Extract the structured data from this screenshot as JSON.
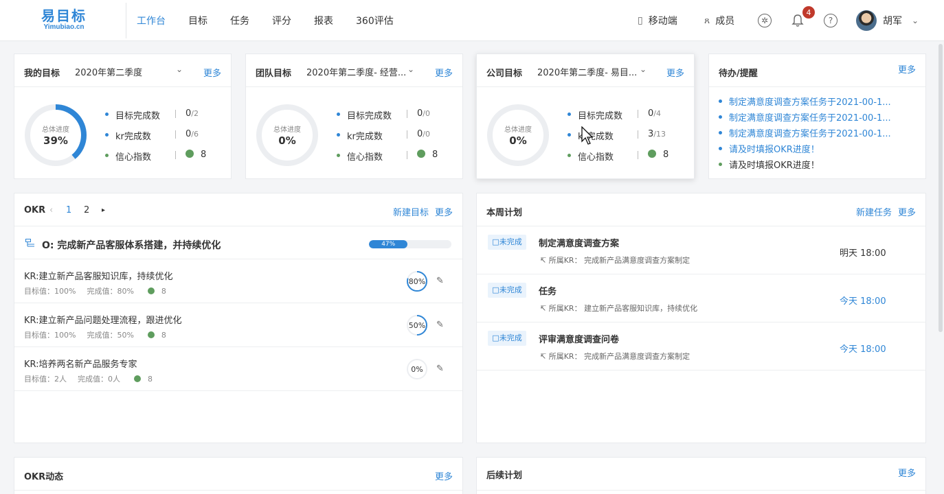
{
  "logo": {
    "cn": "易目标",
    "en": "Yimubiao.cn"
  },
  "nav": [
    "工作台",
    "目标",
    "任务",
    "评分",
    "报表",
    "360评估"
  ],
  "header": {
    "mobile": "移动端",
    "members": "成员",
    "notification_count": "4",
    "help": "?",
    "user": "胡军"
  },
  "stat_labels": {
    "goal_done": "目标完成数",
    "kr_done": "kr完成数",
    "confidence": "信心指数",
    "progress": "总体进度"
  },
  "my_goal": {
    "title": "我的目标",
    "period": "2020年第二季度",
    "more": "更多",
    "progress": "39%",
    "progress_value": 0.39,
    "goal_done": "0",
    "goal_total": "/2",
    "kr_done": "0",
    "kr_total": "/6",
    "confidence": "8"
  },
  "team_goal": {
    "title": "团队目标",
    "period": "2020年第二季度- 经营...",
    "more": "更多",
    "progress": "0%",
    "progress_value": 0,
    "goal_done": "0",
    "goal_total": "/0",
    "kr_done": "0",
    "kr_total": "/0",
    "confidence": "8"
  },
  "company_goal": {
    "title": "公司目标",
    "period": "2020年第二季度- 易目...",
    "more": "更多",
    "progress": "0%",
    "progress_value": 0,
    "goal_done": "0",
    "goal_total": "/4",
    "kr_done": "3",
    "kr_total": "/13",
    "confidence": "8"
  },
  "todo": {
    "title": "待办/提醒",
    "more": "更多",
    "items": [
      {
        "text": "制定满意度调查方案任务于2021-00-1...",
        "color": "#2f86d6"
      },
      {
        "text": "制定满意度调查方案任务于2021-00-1...",
        "color": "#2f86d6"
      },
      {
        "text": "制定满意度调查方案任务于2021-00-1...",
        "color": "#2f86d6"
      },
      {
        "text": "请及时填报OKR进度！",
        "color": "#2f86d6"
      },
      {
        "text": "请及时填报OKR进度！",
        "color": "#333333"
      }
    ]
  },
  "okr": {
    "title": "OKR",
    "pages": [
      "1",
      "2"
    ],
    "new_goal": "新建目标",
    "more": "更多",
    "objective": {
      "title": "O: 完成新产品客服体系搭建，并持续优化",
      "progress": "47%",
      "progress_value": 0.47
    },
    "krs": [
      {
        "title": "KR:建立新产品客服知识库，持续优化",
        "target": "目标值：100%",
        "done": "完成值：80%",
        "confidence": "8",
        "pct": "80%",
        "value": 0.8
      },
      {
        "title": "KR:建立新产品问题处理流程，跟进优化",
        "target": "目标值：100%",
        "done": "完成值：50%",
        "confidence": "8",
        "pct": "50%",
        "value": 0.5
      },
      {
        "title": "KR:培养两名新产品服务专家",
        "target": "目标值：2人",
        "done": "完成值：0人",
        "confidence": "8",
        "pct": "0%",
        "value": 0
      }
    ]
  },
  "weekly_plan": {
    "title": "本周计划",
    "new_task": "新建任务",
    "more": "更多",
    "tasks": [
      {
        "status": "□未完成",
        "title": "制定满意度调查方案",
        "kr": "所属KR：  完成新产品满意度调查方案制定",
        "time": "明天 18:00",
        "time_color": "#333333"
      },
      {
        "status": "□未完成",
        "title": "任务",
        "kr": "所属KR：  建立新产品客服知识库，持续优化",
        "time": "今天 18:00",
        "time_color": "#2f86d6"
      },
      {
        "status": "□未完成",
        "title": "评审满意度调查问卷",
        "kr": "所属KR：  完成新产品满意度调查方案制定",
        "time": "今天 18:00",
        "time_color": "#2f86d6"
      }
    ]
  },
  "okr_feed": {
    "title": "OKR动态",
    "more": "更多"
  },
  "later_plan": {
    "title": "后续计划",
    "more": "更多"
  },
  "colors": {
    "accent": "#2f86d6",
    "green": "#5f9d5e",
    "badge": "#c0392b"
  }
}
